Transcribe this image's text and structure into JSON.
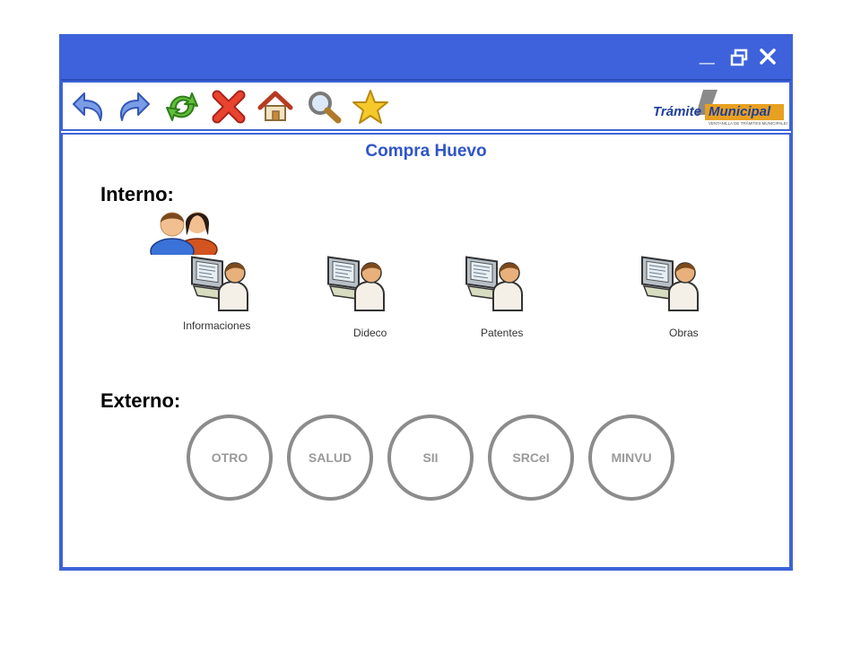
{
  "window": {
    "controls": {
      "minimize": "_"
    }
  },
  "toolbar": {
    "tools": [
      {
        "icon": "back-arrow-icon"
      },
      {
        "icon": "forward-arrow-icon"
      },
      {
        "icon": "refresh-icon"
      },
      {
        "icon": "delete-icon"
      },
      {
        "icon": "home-icon"
      },
      {
        "icon": "search-icon"
      },
      {
        "icon": "star-icon"
      }
    ],
    "brand": {
      "word1": "Trámite",
      "word2": "Municipal",
      "tagline": "VENTANILLA DE TRÁMITES MUNICIPALES"
    }
  },
  "page": {
    "title": "Compra Huevo"
  },
  "interno": {
    "label": "Interno:",
    "departments": [
      {
        "label": "Informaciones"
      },
      {
        "label": "Dideco"
      },
      {
        "label": "Patentes"
      },
      {
        "label": "Obras"
      }
    ]
  },
  "externo": {
    "label": "Externo:",
    "items": [
      "OTRO",
      "SALUD",
      "SII",
      "SRCeI",
      "MINVU"
    ]
  },
  "colors": {
    "window_blue": "#3e62db",
    "title_text": "#2f55c8",
    "circle_border": "#8c8c8c",
    "circle_text": "#9a9a9a"
  }
}
